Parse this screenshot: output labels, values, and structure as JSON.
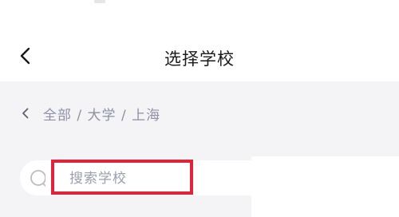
{
  "header": {
    "title": "选择学校",
    "back_icon": "chevron-left-icon"
  },
  "breadcrumb": {
    "back_icon": "chevron-left-icon",
    "path": "全部 / 大学 / 上海"
  },
  "search": {
    "placeholder": "搜索学校",
    "value": "",
    "icon": "search-icon"
  },
  "colors": {
    "highlight": "#e0243b",
    "page_background": "#f4f4f6",
    "breadcrumb_text": "#8c92a4"
  }
}
